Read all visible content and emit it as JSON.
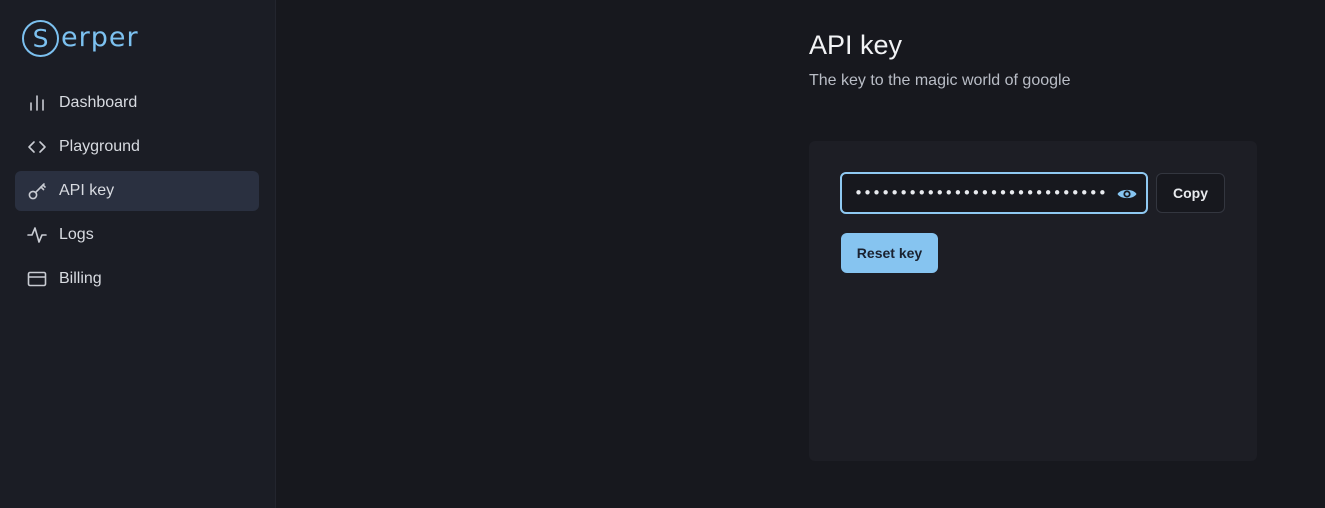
{
  "brand": {
    "logo_letter": "S",
    "logo_rest": "erper",
    "color": "#7cc1f0"
  },
  "sidebar": {
    "items": [
      {
        "label": "Dashboard",
        "icon": "bar-chart-icon",
        "active": false
      },
      {
        "label": "Playground",
        "icon": "code-icon",
        "active": false
      },
      {
        "label": "API key",
        "icon": "key-icon",
        "active": true
      },
      {
        "label": "Logs",
        "icon": "activity-icon",
        "active": false
      },
      {
        "label": "Billing",
        "icon": "credit-card-icon",
        "active": false
      }
    ]
  },
  "main": {
    "title": "API key",
    "subtitle": "The key to the magic world of google",
    "api_key": {
      "masked_value": "••••••••••••••••••••••••••••••••",
      "reveal_icon": "eye-icon",
      "copy_label": "Copy",
      "reset_label": "Reset key"
    }
  },
  "colors": {
    "accent": "#86c4f0",
    "background": "#17181e",
    "sidebar": "#1b1d25",
    "card": "#1d1e25"
  }
}
